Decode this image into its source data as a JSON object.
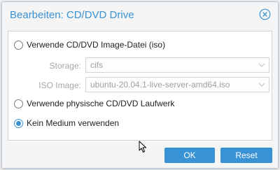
{
  "dialog": {
    "title": "Bearbeiten: CD/DVD Drive",
    "close_icon": "close-circle-icon"
  },
  "options": {
    "iso": {
      "label": "Verwende CD/DVD Image-Datei (iso)",
      "checked": false,
      "storage": {
        "label": "Storage:",
        "value": "cifs",
        "disabled": true
      },
      "iso_image": {
        "label": "ISO Image:",
        "value": "ubuntu-20.04.1-live-server-amd64.iso",
        "disabled": true
      }
    },
    "physical": {
      "label": "Verwende physische CD/DVD Laufwerk",
      "checked": false
    },
    "none": {
      "label": "Kein Medium verwenden",
      "checked": true
    }
  },
  "buttons": {
    "ok": "OK",
    "reset": "Reset"
  },
  "colors": {
    "accent": "#3892d4",
    "disabled_text": "#a6a6a6"
  }
}
